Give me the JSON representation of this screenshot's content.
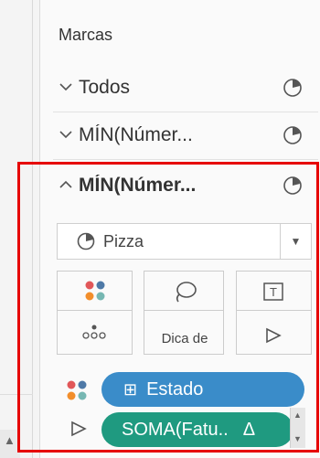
{
  "panel": {
    "title": "Marcas"
  },
  "cards": [
    {
      "label": "Todos",
      "expanded": false
    },
    {
      "label": "MÍN(Númer...",
      "expanded": false
    },
    {
      "label": "MÍN(Númer...",
      "expanded": true
    }
  ],
  "mark_type": {
    "selected": "Pizza",
    "icon": "pie-icon"
  },
  "buttons": {
    "color": {
      "icon": "color-dots-icon"
    },
    "size": {
      "icon": "lasso-icon"
    },
    "label": {
      "icon": "text-icon"
    },
    "detail": {
      "icon": "dots-icon"
    },
    "tooltip": {
      "label": "Dica de"
    },
    "angle": {
      "icon": "angle-icon"
    }
  },
  "pills": [
    {
      "label": "Estado",
      "prefix": "⊞",
      "icon": "color-dots-icon",
      "color": "#3a8cc9"
    },
    {
      "label": "SOMA(Fatu..",
      "suffix": "Δ",
      "icon": "angle-icon",
      "color": "#1f9a80"
    }
  ],
  "colors": {
    "highlight": "#e60000",
    "accent_blue": "#3a8cc9",
    "accent_green": "#1f9a80"
  }
}
